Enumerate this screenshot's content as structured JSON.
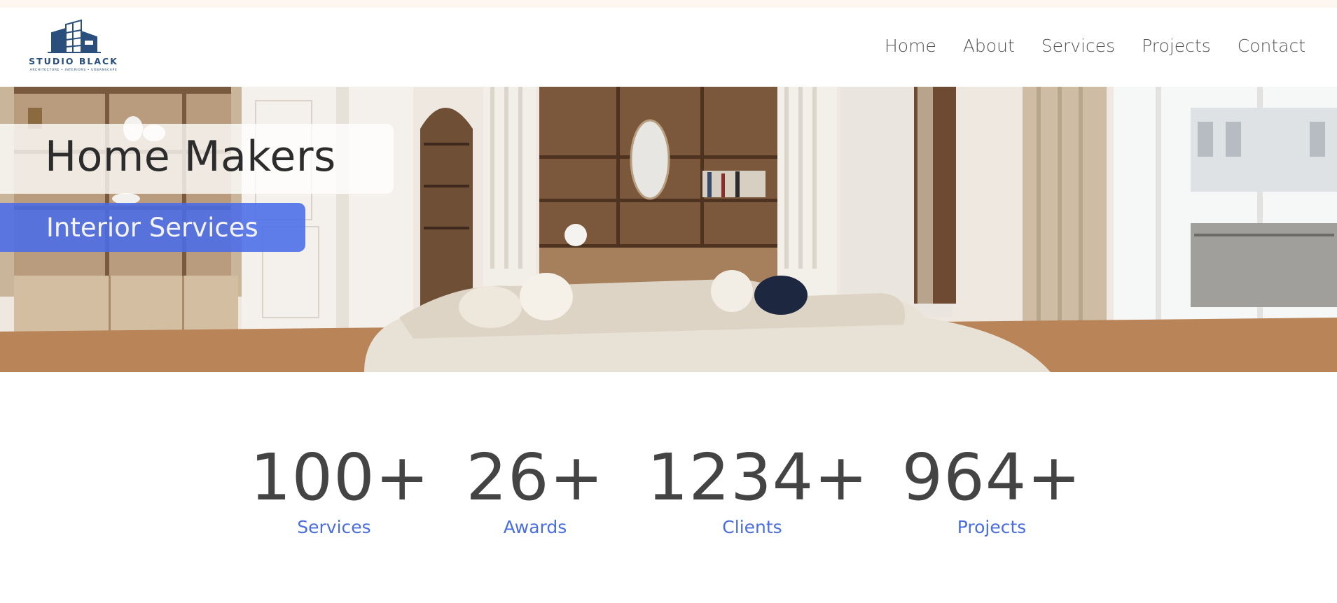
{
  "brand": {
    "name": "STUDIO BLACK",
    "tagline": "ARCHITECTURE • INTERIORS • URBANSCAPE",
    "color": "#2a4f7d"
  },
  "nav": {
    "items": [
      {
        "label": "Home"
      },
      {
        "label": "About"
      },
      {
        "label": "Services"
      },
      {
        "label": "Projects"
      },
      {
        "label": "Contact"
      }
    ]
  },
  "hero": {
    "title": "Home Makers",
    "subtitle": "Interior Services",
    "accent": "#4a6ce8"
  },
  "stats": [
    {
      "value": "100+",
      "label": "Services"
    },
    {
      "value": "26+",
      "label": "Awards"
    },
    {
      "value": "1234+",
      "label": "Clients"
    },
    {
      "value": "964+",
      "label": "Projects"
    }
  ]
}
